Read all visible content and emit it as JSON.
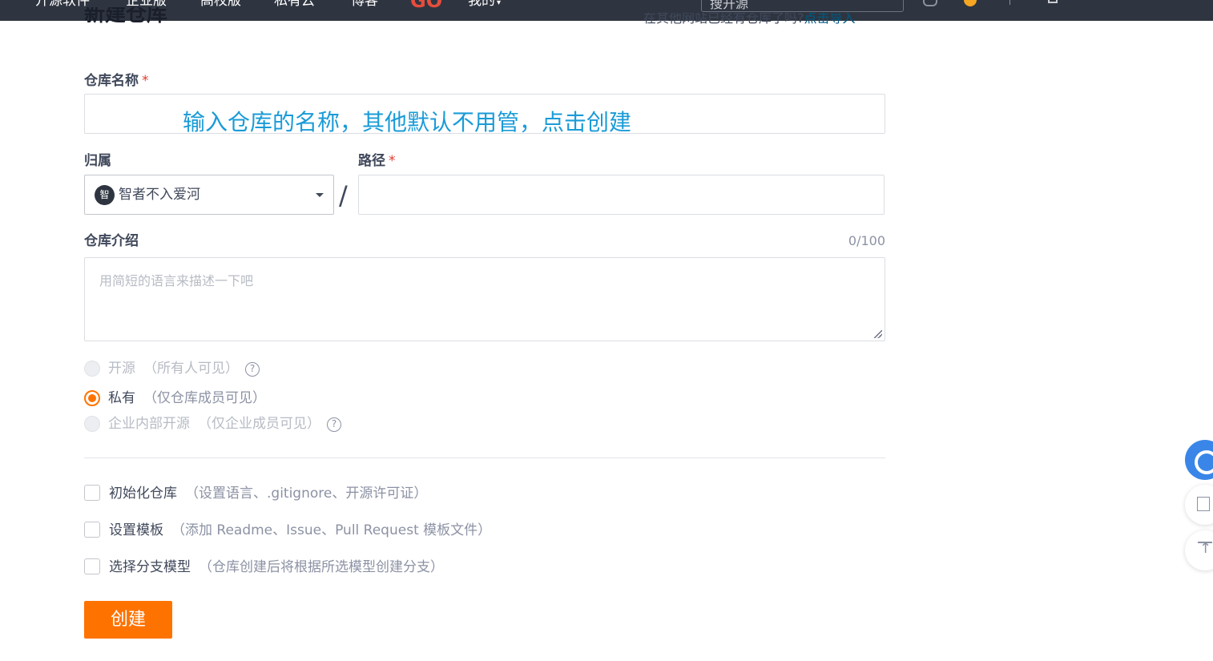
{
  "nav": {
    "items": [
      "开源软件",
      "企业版",
      "高校版",
      "私有云",
      "博客"
    ],
    "go_logo": "GO",
    "my_label": "我的",
    "search_placeholder": "搜开源",
    "icons": [
      "bell-icon",
      "bulb-icon",
      "plus-icon"
    ]
  },
  "page": {
    "title": "新建仓库",
    "import_hint": "在其他网站已经有仓库了吗?",
    "import_link": "点击导入"
  },
  "form": {
    "name_label": "仓库名称",
    "required_mark": "*",
    "name_value": "",
    "annotation": "输入仓库的名称，其他默认不用管，点击创建",
    "owner_label": "归属",
    "owner_avatar_char": "智",
    "owner_value": "智者不入爱河",
    "path_separator": "/",
    "path_label": "路径",
    "path_value": "",
    "desc_label": "仓库介绍",
    "desc_counter": "0/100",
    "desc_placeholder": "用简短的语言来描述一下吧",
    "visibility": [
      {
        "label": "开源",
        "note": "（所有人可见）",
        "state": "disabled",
        "help": true
      },
      {
        "label": "私有",
        "note": "（仅仓库成员可见）",
        "state": "checked",
        "help": false
      },
      {
        "label": "企业内部开源",
        "note": "（仅企业成员可见）",
        "state": "disabled",
        "help": true
      }
    ],
    "options": [
      {
        "label": "初始化仓库",
        "note": "（设置语言、.gitignore、开源许可证）",
        "checked": false
      },
      {
        "label": "设置模板",
        "note": "（添加 Readme、Issue、Pull Request 模板文件）",
        "checked": false
      },
      {
        "label": "选择分支模型",
        "note": "（仓库创建后将根据所选模型创建分支）",
        "checked": false
      }
    ],
    "help_glyph": "?",
    "submit_label": "创建"
  },
  "colors": {
    "accent": "#fe7300",
    "nav_bg": "#2f3540",
    "link": "#005980",
    "annotation": "#1a9bd7",
    "required": "#e4392d"
  },
  "floating": [
    "float-logo",
    "edit-icon",
    "back-to-top-icon"
  ]
}
